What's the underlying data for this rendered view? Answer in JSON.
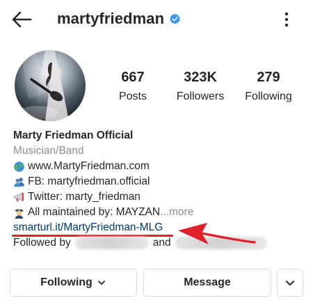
{
  "header": {
    "username": "martyfriedman",
    "verified": true
  },
  "stats": {
    "posts": {
      "value": "667",
      "label": "Posts"
    },
    "followers": {
      "value": "323K",
      "label": "Followers"
    },
    "following": {
      "value": "279",
      "label": "Following"
    }
  },
  "bio": {
    "name": "Marty Friedman Official",
    "category": "Musician/Band",
    "lines": [
      {
        "icon": "globe-emoji",
        "text": "www.MartyFriedman.com"
      },
      {
        "icon": "people-silhouette-emoji",
        "text": "FB: martyfriedman.official"
      },
      {
        "icon": "megaphone-emoji",
        "text": "Twitter: marty_friedman"
      },
      {
        "icon": "police-officer-emoji",
        "text": "All maintained by:  MAYZAN"
      }
    ],
    "ellipsis": "...",
    "more_label": " more",
    "link": "smarturl.it/MartyFriedman-MLG",
    "followed_by": "Followed by",
    "and_label": "and"
  },
  "actions": {
    "following_label": "Following",
    "message_label": "Message"
  },
  "colors": {
    "text": "#262626",
    "secondary": "#8e8e8e",
    "link": "#00376b",
    "verified": "#3897f0",
    "annotation": "#e0202a",
    "border": "#dbdbdb"
  }
}
